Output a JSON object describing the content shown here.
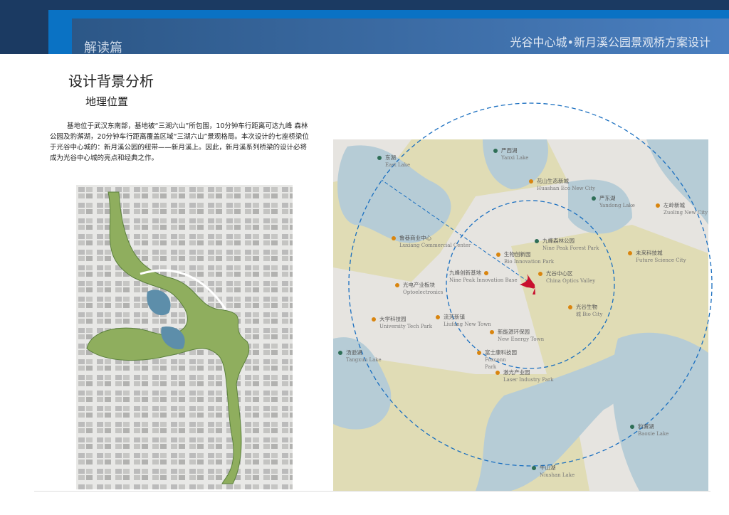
{
  "header": {
    "section": "解读篇",
    "project": "光谷中心城•新月溪公园景观桥方案设计"
  },
  "page": {
    "title": "设计背景分析",
    "subtitle": "地理位置",
    "body": "基地位于武汉东南部，基地被“三湖六山”所包围，10分钟车行距离可达九峰 森林公园及豹澥湖，20分钟车行距离覆盖区域“三湖六山”景观格局。本次设计的七座桥梁位于光谷中心城的：新月溪公园的纽带——新月溪上。因此，新月溪系列桥梁的设计必将成为光谷中心城的亮点和经典之作。"
  },
  "colors": {
    "header_dark": "#1b3a62",
    "header_blue": "#0a72c4",
    "orange_poi": "#d9850f",
    "green_poi": "#2e6e56",
    "circle": "#1a6fc0",
    "site": "#c8102e"
  },
  "map": {
    "places": [
      {
        "cn": "东湖",
        "en": "East Lake",
        "type": "lake"
      },
      {
        "cn": "严西湖",
        "en": "Yanxi Lake",
        "type": "lake"
      },
      {
        "cn": "花山生态新城",
        "en": "Huashan Eco New City",
        "type": "district"
      },
      {
        "cn": "严东湖",
        "en": "Yandong Lake",
        "type": "lake"
      },
      {
        "cn": "左岭新城",
        "en": "Zuoling New City",
        "type": "district"
      },
      {
        "cn": "鲁巷商业中心",
        "en": "Luxiang Commercial Center",
        "type": "district"
      },
      {
        "cn": "九峰森林公园",
        "en": "Nine Peak Forest Park",
        "type": "lake"
      },
      {
        "cn": "未来科技城",
        "en": "Future Science City",
        "type": "district"
      },
      {
        "cn": "生物创新园",
        "en": "Bio Innovation Park",
        "type": "district"
      },
      {
        "cn": "九峰创新基地",
        "en": "Nine Peak Innovation Base",
        "type": "district"
      },
      {
        "cn": "光谷中心区",
        "en": "China Optics Valley",
        "type": "district"
      },
      {
        "cn": "光电产业板块",
        "en": "Optoelectronics",
        "type": "district"
      },
      {
        "cn": "光谷生物",
        "en": "城 Bio City",
        "type": "district"
      },
      {
        "cn": "大学科技园",
        "en": "University Tech Park",
        "type": "district"
      },
      {
        "cn": "流芳新镇",
        "en": "Liufang New Town",
        "type": "district"
      },
      {
        "cn": "新能源环保园",
        "en": "New Energy Town",
        "type": "district"
      },
      {
        "cn": "富士康科技园",
        "en": "Foxconn Park",
        "type": "district"
      },
      {
        "cn": "激光产业园",
        "en": "Laser Industry Park",
        "type": "district"
      },
      {
        "cn": "汤逊湖",
        "en": "Tangxun Lake",
        "type": "lake"
      },
      {
        "cn": "豹澥湖",
        "en": "Baoxie Lake",
        "type": "lake"
      },
      {
        "cn": "牛山湖",
        "en": "Niushan Lake",
        "type": "lake"
      }
    ]
  }
}
